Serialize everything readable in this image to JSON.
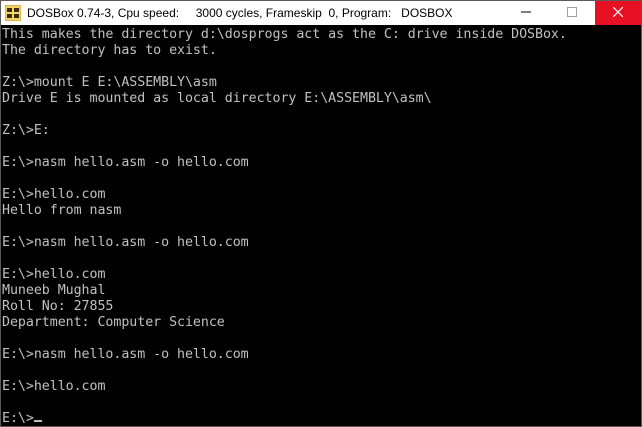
{
  "window": {
    "title": "DOSBox 0.74-3, Cpu speed:     3000 cycles, Frameskip  0, Program:   DOSBOX",
    "icon": "dosbox-icon",
    "controls": {
      "minimize_icon": "minimize-icon",
      "maximize_icon": "maximize-icon",
      "close_icon": "close-icon",
      "close_color": "#e81123"
    }
  },
  "terminal": {
    "text_color": "#c0c0c0",
    "background": "#000000",
    "lines": [
      "This makes the directory d:\\dosprogs act as the C: drive inside DOSBox.",
      "The directory has to exist.",
      "",
      "Z:\\>mount E E:\\ASSEMBLY\\asm",
      "Drive E is mounted as local directory E:\\ASSEMBLY\\asm\\",
      "",
      "Z:\\>E:",
      "",
      "E:\\>nasm hello.asm -o hello.com",
      "",
      "E:\\>hello.com",
      "Hello from nasm",
      "",
      "E:\\>nasm hello.asm -o hello.com",
      "",
      "E:\\>hello.com",
      "Muneeb Mughal",
      "Roll No: 27855",
      "Department: Computer Science",
      "",
      "E:\\>nasm hello.asm -o hello.com",
      "",
      "E:\\>hello.com",
      ""
    ],
    "prompt": "E:\\>"
  }
}
